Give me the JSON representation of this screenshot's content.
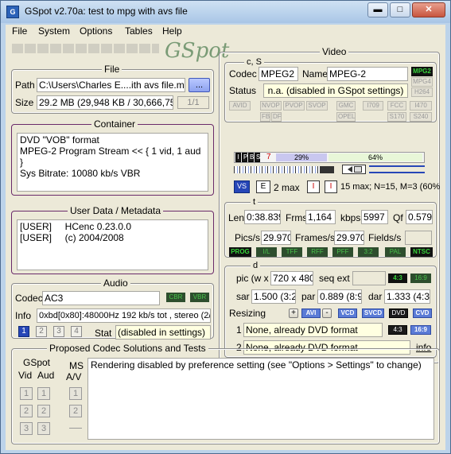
{
  "window": {
    "title": "GSpot v2.70a: test to mpg with avs file",
    "icon_name": "gspot-app-icon"
  },
  "menu": [
    "File",
    "System",
    "Options",
    "Tables",
    "Help"
  ],
  "logo_text": "GSpot",
  "file": {
    "legend": "File",
    "path_label": "Path",
    "path_value": "C:\\Users\\Charles E....ith avs file.mpg",
    "browse_label": "...",
    "size_label": "Size",
    "size_value": "29.2 MB (29,948 KB / 30,666,752 b",
    "counter": "1/1"
  },
  "container": {
    "legend": "Container",
    "lines": [
      "DVD \"VOB\" format",
      "MPEG-2 Program Stream << { 1 vid, 1 aud }",
      "Sys Bitrate: 10080 kb/s VBR"
    ]
  },
  "userdata": {
    "legend": "User Data / Metadata",
    "lines": [
      "[USER]     HCenc 0.23.0.0",
      "[USER]     (c) 2004/2008"
    ]
  },
  "audio": {
    "legend": "Audio",
    "codec_label": "Codec",
    "codec_value": "AC3",
    "cbr": "CBR",
    "vbr": "VBR",
    "info_label": "Info",
    "info_value": "0xbd[0x80]:48000Hz  192 kb/s tot , stereo (2/0",
    "streams": [
      "1",
      "2",
      "3",
      "4"
    ],
    "stat_label": "Stat",
    "stat_value": "(disabled in settings)"
  },
  "video": {
    "legend": "Video",
    "cs_legend": "c, S",
    "codec_label": "Codec",
    "codec_value": "MPEG2",
    "name_label": "Name",
    "name_value": "MPEG-2",
    "codec_tags": [
      "MPG2",
      "MPG4",
      "H264"
    ],
    "status_label": "Status",
    "status_value": "n.a. (disabled in GSpot settings)",
    "flag_tags": [
      "AVID",
      "NVOP",
      "PVOP",
      "SVOP",
      "GMC",
      "I709",
      "FCC",
      "I470",
      "FB",
      "DF",
      "OPEL",
      "S170",
      "S240"
    ],
    "frame_types": [
      "I",
      "P",
      "B",
      "S"
    ],
    "gop_value": "7",
    "pct1": "29%",
    "pct2": "64%",
    "gop_label1": "2 max",
    "gop_label2": "15 max; N=15, M=3 (60%",
    "t_legend": "t",
    "len_label": "Len",
    "len_value": "0:38.839",
    "frms_label": "Frms",
    "frms_value": "1,164",
    "kbps_label": "kbps",
    "kbps_value": "5997",
    "qf_label": "Qf",
    "qf_value": "0.579",
    "pics_label": "Pics/s",
    "pics_value": "29.970",
    "frames_label": "Frames/s",
    "frames_value": "29.970",
    "fields_label": "Fields/s",
    "fields_value": "",
    "std_tags": [
      "PROG",
      "I/L",
      "TFF",
      "RFF",
      "PFF",
      "3:2",
      "PAL",
      "NTSC"
    ],
    "d_legend": "d",
    "pic_label": "pic (w x",
    "pic_value": "720 x 480",
    "seqext_label": "seq ext",
    "ar_tags": [
      "4:3",
      "16:9"
    ],
    "sar_label": "sar",
    "sar_value": "1.500 (3:2)",
    "par_label": "par",
    "par_value": "0.889 (8:9)",
    "dar_label": "dar",
    "dar_value": "1.333 (4:3)",
    "resizing_label": "Resizing",
    "resize_tags": [
      "+",
      "AVI",
      "-",
      "VCD",
      "SVCD",
      "DVD",
      "CVD"
    ],
    "res1_num": "1",
    "res1_value": "None, already DVD format",
    "res2_num": "2",
    "res2_value": "None, already DVD format",
    "ar_tags2": [
      "4:3",
      "16:9"
    ],
    "info_link": "info"
  },
  "proposed": {
    "legend": "Proposed Codec Solutions and Tests",
    "gspot_label": "GSpot",
    "vid_label": "Vid",
    "aud_label": "Aud",
    "ms_label": "MS",
    "av_label": "A/V",
    "nums": [
      "1",
      "2",
      "3"
    ],
    "message": "Rendering disabled by preference setting (see \"Options > Settings\" to change)"
  },
  "colors": {
    "accent_green": "#37d33a",
    "accent_blue": "#2646b7",
    "panel_bg": "#ece9d8",
    "window_frame": "#bcd3ea"
  }
}
